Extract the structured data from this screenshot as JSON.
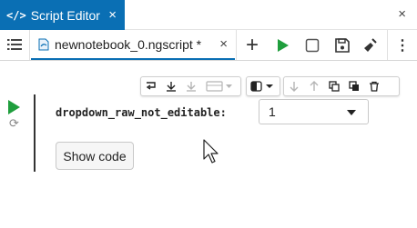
{
  "panel": {
    "icon": "</>",
    "title": "Script Editor",
    "close_glyph": "×"
  },
  "window": {
    "close_glyph": "×"
  },
  "toolbar": {
    "menu_icon": "list-icon",
    "tab": {
      "filename": "newnotebook_0.ngscript *",
      "close_glyph": "×"
    },
    "add_glyph": "+",
    "more_glyph": "⋮"
  },
  "cell_toolbar": {
    "group1": [
      "insert-cell-icon",
      "insert-below-icon",
      "insert-below-disabled-icon",
      "cell-type-dropdown-icon"
    ],
    "group2": [
      "output-toggle-icon"
    ],
    "group3": [
      "move-down-icon",
      "move-up-icon",
      "copy-icon",
      "paste-icon",
      "delete-icon"
    ]
  },
  "cell": {
    "param_label": "dropdown_raw_not_editable:",
    "dropdown_value": "1",
    "show_code_label": "Show code"
  },
  "colors": {
    "accent": "#0a6fb4",
    "run_green": "#1f9e3d",
    "save_gray": "#333333"
  }
}
